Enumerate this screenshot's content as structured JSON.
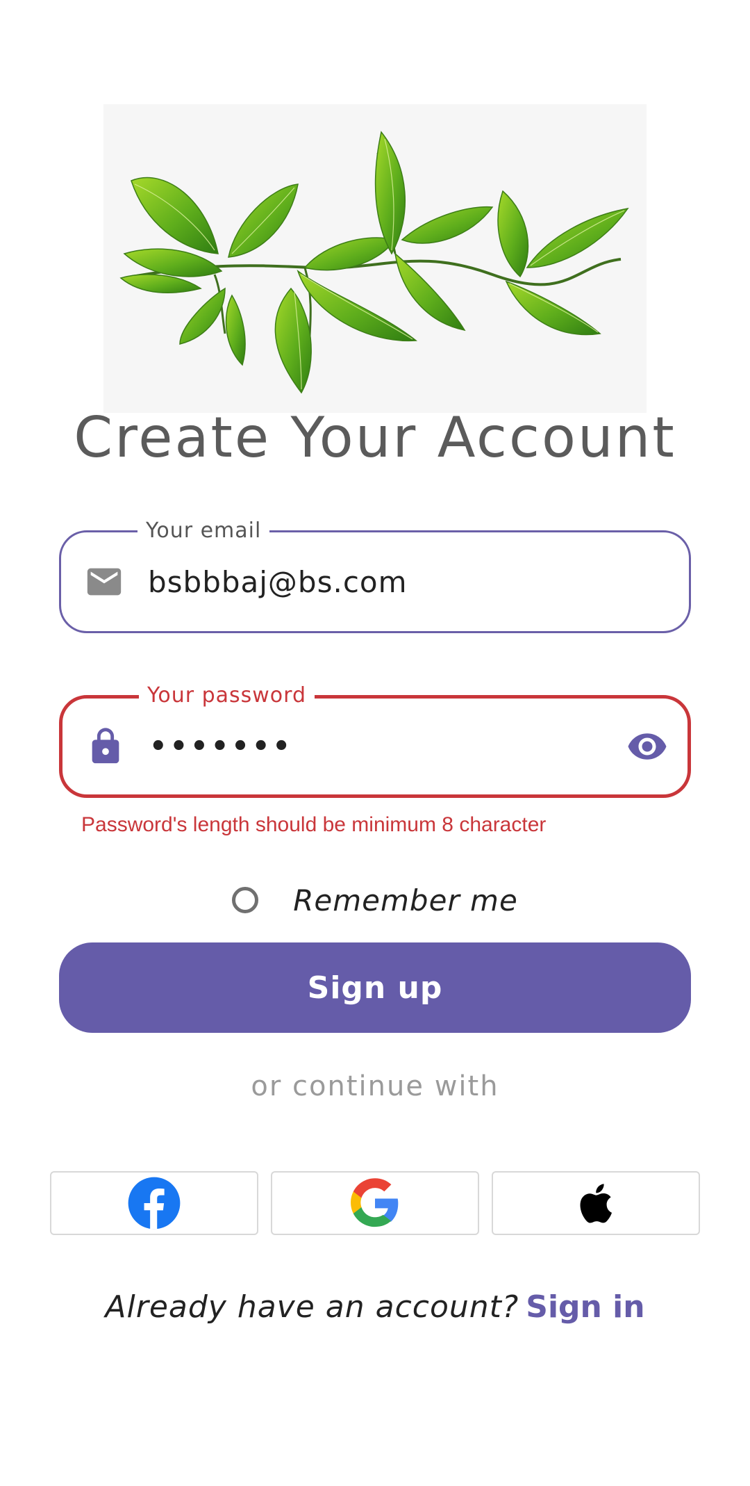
{
  "colors": {
    "accent": "#655ca9",
    "error": "#c9363a",
    "muted": "#9a9a9a"
  },
  "hero": {
    "image": "green-leaves-branch"
  },
  "title": "Create Your Account",
  "email_field": {
    "label": "Your email",
    "value": "bsbbbaj@bs.com",
    "icon": "email-icon"
  },
  "password_field": {
    "label": "Your password",
    "value": "•••••••",
    "icon": "lock-icon",
    "toggle_icon": "eye-icon",
    "error": "Password's length should be minimum 8 character"
  },
  "remember": {
    "label": "Remember me",
    "checked": false
  },
  "signup_button": "Sign up",
  "divider_text": "or continue with",
  "social": [
    {
      "name": "facebook",
      "icon": "facebook-icon"
    },
    {
      "name": "google",
      "icon": "google-icon"
    },
    {
      "name": "apple",
      "icon": "apple-icon"
    }
  ],
  "footer": {
    "prompt": "Already have an account?",
    "link": "Sign in"
  }
}
